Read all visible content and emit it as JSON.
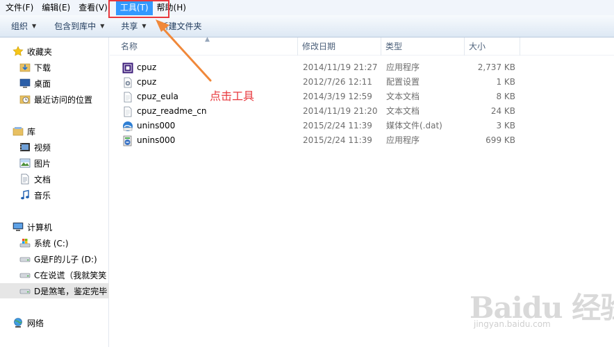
{
  "menubar": {
    "items": [
      {
        "label": "文件(F)"
      },
      {
        "label": "编辑(E)"
      },
      {
        "label": "查看(V)"
      },
      {
        "label": "工具(T)"
      },
      {
        "label": "帮助(H)"
      }
    ]
  },
  "toolbar": {
    "organize": "组织",
    "include_in_library": "包含到库中",
    "share": "共享",
    "new_folder": "新建文件夹"
  },
  "sidebar": {
    "favorites": {
      "label": "收藏夹",
      "items": [
        {
          "label": "下载",
          "icon": "download-folder-icon"
        },
        {
          "label": "桌面",
          "icon": "desktop-icon"
        },
        {
          "label": "最近访问的位置",
          "icon": "recent-places-icon"
        }
      ]
    },
    "libraries": {
      "label": "库",
      "items": [
        {
          "label": "视频",
          "icon": "video-library-icon"
        },
        {
          "label": "图片",
          "icon": "pictures-library-icon"
        },
        {
          "label": "文档",
          "icon": "documents-library-icon"
        },
        {
          "label": "音乐",
          "icon": "music-library-icon"
        }
      ]
    },
    "computer": {
      "label": "计算机",
      "items": [
        {
          "label": "系统 (C:)",
          "icon": "system-drive-icon"
        },
        {
          "label": "G是F的儿子 (D:)",
          "icon": "drive-icon"
        },
        {
          "label": "C在说谎（我就笑笑",
          "icon": "drive-icon"
        },
        {
          "label": "D是煞笔，鉴定完毕",
          "icon": "drive-icon",
          "selected": true
        }
      ]
    },
    "network": {
      "label": "网络"
    }
  },
  "columns": {
    "name": "名称",
    "date": "修改日期",
    "type": "类型",
    "size": "大小"
  },
  "files": [
    {
      "name": "cpuz",
      "date": "2014/11/19 21:27",
      "type": "应用程序",
      "size": "2,737 KB",
      "icon": "cpuz-app-icon"
    },
    {
      "name": "cpuz",
      "date": "2012/7/26 12:11",
      "type": "配置设置",
      "size": "1 KB",
      "icon": "config-file-icon"
    },
    {
      "name": "cpuz_eula",
      "date": "2014/3/19 12:59",
      "type": "文本文档",
      "size": "8 KB",
      "icon": "text-file-icon"
    },
    {
      "name": "cpuz_readme_cn",
      "date": "2014/11/19 21:20",
      "type": "文本文档",
      "size": "24 KB",
      "icon": "text-file-icon"
    },
    {
      "name": "unins000",
      "date": "2015/2/24 11:39",
      "type": "媒体文件(.dat)",
      "size": "3 KB",
      "icon": "media-file-icon"
    },
    {
      "name": "unins000",
      "date": "2015/2/24 11:39",
      "type": "应用程序",
      "size": "699 KB",
      "icon": "uninstaller-icon"
    }
  ],
  "annotation": {
    "text": "点击工具",
    "color": "#e8383d"
  },
  "watermark": {
    "main": "Baidu 经验",
    "sub": "jingyan.baidu.com"
  },
  "colors": {
    "menu_highlight": "#3399ff",
    "toolbar_text": "#1e395b",
    "column_header_text": "#4c607a",
    "annotation": "#e8383d"
  }
}
